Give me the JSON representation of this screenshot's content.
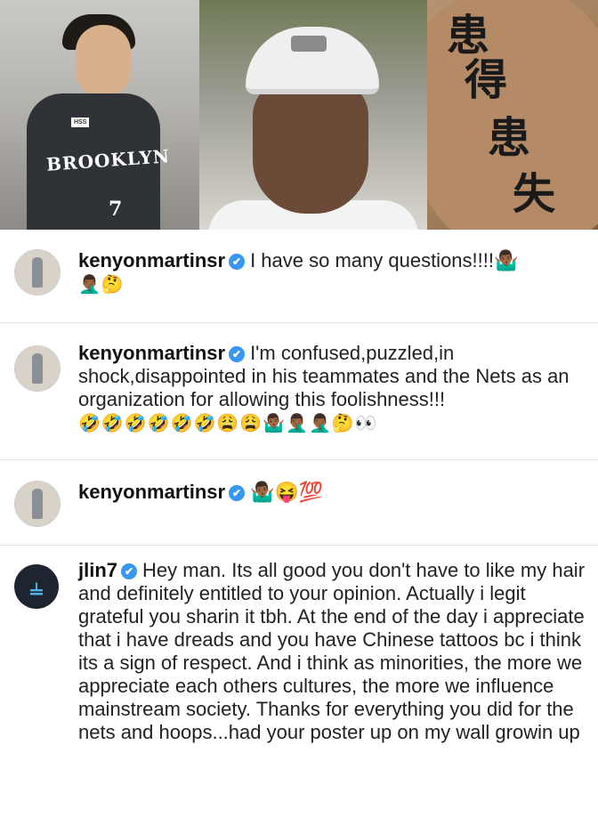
{
  "photos": {
    "left": {
      "jersey_text": "BROOKLYN",
      "jersey_number": "7",
      "patch": "HSS"
    },
    "right": {
      "tattoo_chars": [
        "患",
        "得",
        "患",
        "失"
      ]
    }
  },
  "comments": [
    {
      "username": "kenyonmartinsr",
      "verified_glyph": "✔",
      "text": "I have so many questions!!!!🤷🏾‍♂️",
      "emojis": "🤦🏾‍♂️🤔"
    },
    {
      "username": "kenyonmartinsr",
      "verified_glyph": "✔",
      "text": "I'm confused,puzzled,in shock,disappointed in his teammates and the Nets as an organization for allowing this foolishness!!!",
      "emojis": "🤣🤣🤣🤣🤣🤣😩😩🤷🏾‍♂️🤦🏾‍♂️🤦🏾‍♂️🤔👀"
    },
    {
      "username": "kenyonmartinsr",
      "verified_glyph": "✔",
      "text": "🤷🏾‍♂️😝💯",
      "emojis": ""
    },
    {
      "username": "jlin7",
      "verified_glyph": "✔",
      "text": "Hey man. Its all good you don't have to like my hair and definitely entitled to your opinion. Actually i legit grateful you sharin it tbh. At the end of the day i appreciate that i have dreads and you have Chinese tattoos bc i think its a sign of respect. And i think as minorities, the more we appreciate each others cultures, the more we influence mainstream society. Thanks for everything you did for the nets and hoops...had your poster up on my wall growin up",
      "emojis": ""
    }
  ]
}
